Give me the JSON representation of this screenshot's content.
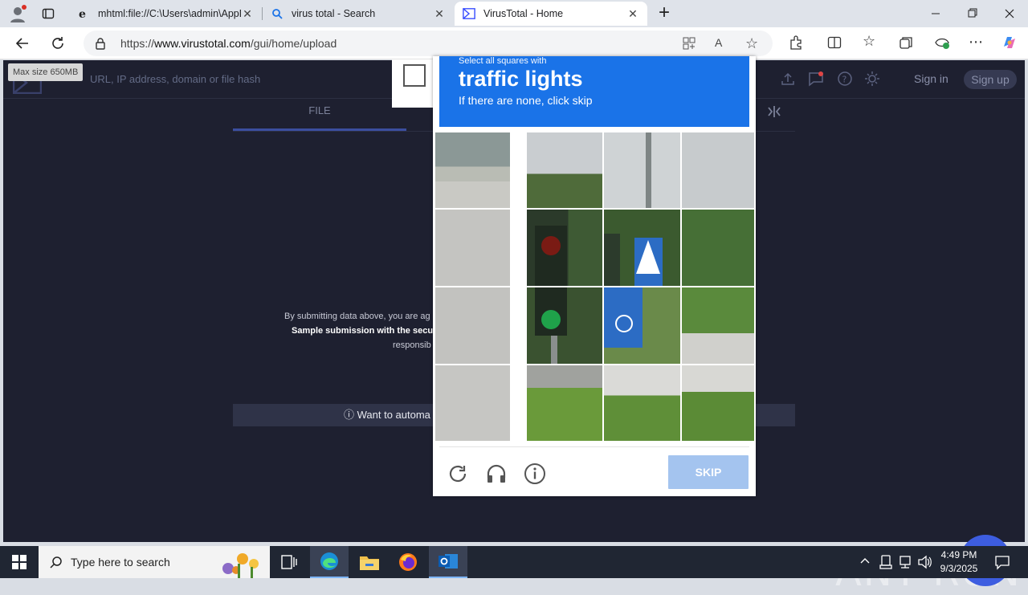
{
  "browser": {
    "tabs": [
      {
        "title": "mhtml:file://C:\\Users\\admin\\AppD",
        "icon": "ie-icon",
        "active": false
      },
      {
        "title": "virus total - Search",
        "icon": "search-icon",
        "active": false
      },
      {
        "title": "VirusTotal - Home",
        "icon": "virustotal-icon",
        "active": true
      }
    ],
    "new_tab_label": "+",
    "url_prefix": "https://",
    "url_host": "www.virustotal.com",
    "url_path": "/gui/home/upload"
  },
  "page": {
    "tooltip": "Max size 650MB",
    "search_placeholder": "URL, IP address, domain or file hash",
    "sign_in": "Sign in",
    "sign_up": "Sign up",
    "tab_file": "FILE",
    "terms_line1": "By submitting data above, you are ag",
    "terms_line2": "Sample submission with the secu",
    "terms_line3": "responsib",
    "automate": "ⓘ  Want to automa"
  },
  "captcha": {
    "instruction_small": "Select all squares with",
    "target": "traffic lights",
    "subtitle": "If there are none, click skip",
    "skip_label": "SKIP",
    "colors": {
      "header": "#1a73e8",
      "skip": "#a4c4ef"
    }
  },
  "watermark": "ANY RUN",
  "taskbar": {
    "search_placeholder": "Type here to search",
    "time": "4:49 PM",
    "date": "9/3/2025"
  }
}
